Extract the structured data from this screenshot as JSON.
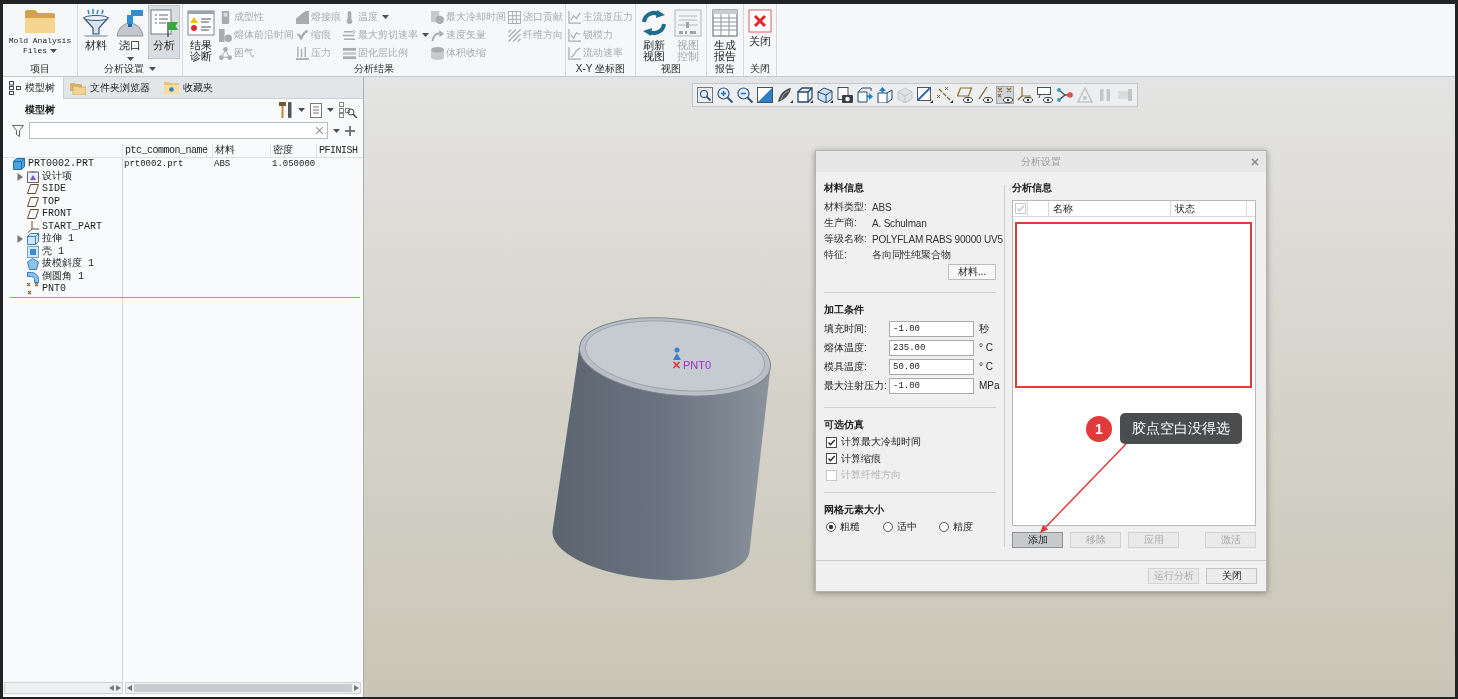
{
  "ribbon": {
    "groups": [
      {
        "label": "项目",
        "dropdown": false,
        "items": [
          {
            "kind": "folder",
            "label": "Mold Analysis Files",
            "dropdown": true,
            "disabled": false,
            "pressed": false
          }
        ]
      },
      {
        "label": "分析设置",
        "dropdown": true,
        "items": [
          {
            "kind": "funnel",
            "label": "材料",
            "dropdown": false,
            "disabled": false,
            "pressed": false
          },
          {
            "kind": "nozzle",
            "label": "浇口",
            "dropdown": true,
            "disabled": false,
            "pressed": false
          },
          {
            "kind": "analysis",
            "label": "分析",
            "dropdown": false,
            "disabled": false,
            "pressed": true
          }
        ]
      },
      {
        "label": "分析结果",
        "dropdown": false,
        "items": [
          {
            "kind": "diagnosis",
            "label": "结果诊断",
            "dropdown": false,
            "disabled": false,
            "pressed": false
          }
        ],
        "columns": [
          [
            {
              "label": "成型性",
              "dropdown": false,
              "disabled": true
            },
            {
              "label": "熔体前沿时间",
              "dropdown": false,
              "disabled": true
            },
            {
              "label": "困气",
              "dropdown": false,
              "disabled": true
            }
          ],
          [
            {
              "label": "熔接痕",
              "dropdown": false,
              "disabled": true
            },
            {
              "label": "缩痕",
              "dropdown": false,
              "disabled": true
            },
            {
              "label": "压力",
              "dropdown": false,
              "disabled": true
            }
          ],
          [
            {
              "label": "温度",
              "dropdown": true,
              "disabled": true
            },
            {
              "label": "最大剪切速率",
              "dropdown": true,
              "disabled": true
            },
            {
              "label": "固化层比例",
              "dropdown": false,
              "disabled": true
            }
          ],
          [
            {
              "label": "最大冷却时间",
              "dropdown": false,
              "disabled": true
            },
            {
              "label": "速度矢量",
              "dropdown": false,
              "disabled": true
            },
            {
              "label": "体积收缩",
              "dropdown": false,
              "disabled": true
            }
          ],
          [
            {
              "label": "浇口贡献",
              "dropdown": false,
              "disabled": true
            },
            {
              "label": "纤维方向",
              "dropdown": false,
              "disabled": true
            }
          ]
        ]
      },
      {
        "label": "X-Y 坐标图",
        "dropdown": false,
        "columns": [
          [
            {
              "label": "主流道压力",
              "dropdown": false,
              "disabled": true
            },
            {
              "label": "锁模力",
              "dropdown": false,
              "disabled": true
            },
            {
              "label": "流动速率",
              "dropdown": false,
              "disabled": true
            }
          ]
        ]
      },
      {
        "label": "视图",
        "dropdown": false,
        "items": [
          {
            "kind": "refresh",
            "label": "刷新视图",
            "dropdown": false,
            "disabled": false,
            "pressed": false
          },
          {
            "kind": "viewctl",
            "label": "视图控制",
            "dropdown": false,
            "disabled": true,
            "pressed": false
          }
        ]
      },
      {
        "label": "报告",
        "dropdown": false,
        "items": [
          {
            "kind": "report",
            "label": "生成报告",
            "dropdown": false,
            "disabled": false,
            "pressed": false
          }
        ]
      },
      {
        "label": "关闭",
        "dropdown": false,
        "items": [
          {
            "kind": "close",
            "label": "关闭",
            "dropdown": false,
            "disabled": false,
            "pressed": false
          }
        ]
      }
    ]
  },
  "model_tree": {
    "tabs": [
      {
        "label": "模型树",
        "selected": true
      },
      {
        "label": "文件夹浏览器",
        "selected": false
      },
      {
        "label": "收藏夹",
        "selected": false
      }
    ],
    "title": "模型树",
    "columns": [
      "ptc_common_name",
      "材料",
      "密度",
      "PFINISH"
    ],
    "items": [
      {
        "kind": "part",
        "name": "PRT0002.PRT",
        "cells": [
          "prt0002.prt",
          "ABS",
          "1.050000"
        ],
        "children": [
          {
            "kind": "items",
            "name": "设计项",
            "expanded": false
          },
          {
            "kind": "plane",
            "name": "SIDE"
          },
          {
            "kind": "plane",
            "name": "TOP"
          },
          {
            "kind": "plane",
            "name": "FRONT"
          },
          {
            "kind": "csys",
            "name": "START_PART"
          },
          {
            "kind": "extrude",
            "name": "拉伸 1",
            "expanded": false
          },
          {
            "kind": "shell",
            "name": "壳 1"
          },
          {
            "kind": "draft",
            "name": "拔模斜度 1"
          },
          {
            "kind": "round",
            "name": "倒圆角 1"
          },
          {
            "kind": "point",
            "name": "PNT0"
          }
        ]
      }
    ]
  },
  "graphics": {
    "toolbar": [
      {
        "kind": "fit",
        "on": false,
        "disabled": false
      },
      {
        "kind": "zoomin",
        "on": false,
        "disabled": false
      },
      {
        "kind": "zoomout",
        "on": false,
        "disabled": false
      },
      {
        "kind": "repaint",
        "on": false,
        "disabled": false
      },
      {
        "kind": "shading",
        "on": false,
        "disabled": false
      },
      {
        "kind": "style",
        "on": false,
        "disabled": false
      },
      {
        "kind": "views",
        "on": false,
        "disabled": false
      },
      {
        "kind": "manager",
        "on": false,
        "disabled": false
      },
      {
        "kind": "orientright",
        "on": false,
        "disabled": false
      },
      {
        "kind": "orientup",
        "on": false,
        "disabled": false
      },
      {
        "kind": "box",
        "on": false,
        "disabled": true
      },
      {
        "kind": "plane",
        "on": false,
        "disabled": false
      },
      {
        "kind": "axis",
        "on": false,
        "disabled": false
      },
      {
        "kind": "planetag",
        "on": false,
        "disabled": false
      },
      {
        "kind": "axistag",
        "on": false,
        "disabled": false
      },
      {
        "kind": "pointtag",
        "on": true,
        "disabled": false
      },
      {
        "kind": "csystag",
        "on": false,
        "disabled": false
      },
      {
        "kind": "notetag",
        "on": false,
        "disabled": false
      },
      {
        "kind": "spin",
        "on": false,
        "disabled": false
      },
      {
        "kind": "warn",
        "on": false,
        "disabled": true
      },
      {
        "kind": "pause",
        "on": false,
        "disabled": true
      },
      {
        "kind": "last",
        "on": false,
        "disabled": true
      }
    ],
    "point_label": "PNT0"
  },
  "dialog": {
    "title": "分析设置",
    "material_info": {
      "heading": "材料信息",
      "rows": [
        {
          "label": "材料类型:",
          "value": "ABS"
        },
        {
          "label": "生产商:",
          "value": "A. Schulman"
        },
        {
          "label": "等级名称:",
          "value": "POLYFLAM RABS 90000 UV5"
        },
        {
          "label": "特征:",
          "value": "各向同性纯聚合物"
        }
      ],
      "button": "材料..."
    },
    "process_conditions": {
      "heading": "加工条件",
      "fields": [
        {
          "label": "填充时间:",
          "value": "-1.00",
          "unit": "秒"
        },
        {
          "label": "熔体温度:",
          "value": "235.00",
          "unit": "° C"
        },
        {
          "label": "模具温度:",
          "value": "50.00",
          "unit": "° C"
        },
        {
          "label": "最大注射压力:",
          "value": "-1.00",
          "unit": "MPa"
        }
      ]
    },
    "optional_simulation": {
      "heading": "可选仿真",
      "options": [
        {
          "label": "计算最大冷却时间",
          "checked": true,
          "disabled": false
        },
        {
          "label": "计算缩痕",
          "checked": true,
          "disabled": false
        },
        {
          "label": "计算纤维方向",
          "checked": false,
          "disabled": true
        }
      ]
    },
    "mesh_size": {
      "heading": "网格元素大小",
      "options": [
        {
          "label": "粗糙",
          "selected": true
        },
        {
          "label": "适中",
          "selected": false
        },
        {
          "label": "精度",
          "selected": false
        }
      ]
    },
    "analysis_info": {
      "heading": "分析信息",
      "header_checkbox": {
        "checked": true,
        "disabled": true
      },
      "columns": [
        "名称",
        "状态"
      ],
      "buttons": [
        {
          "label": "添加",
          "disabled": false,
          "pressed": true
        },
        {
          "label": "移除",
          "disabled": true,
          "pressed": false
        },
        {
          "label": "应用",
          "disabled": true,
          "pressed": false
        },
        {
          "label": "激活",
          "disabled": true,
          "pressed": false
        }
      ]
    },
    "footer_buttons": [
      {
        "label": "运行分析",
        "disabled": true
      },
      {
        "label": "关闭",
        "disabled": false
      }
    ]
  },
  "annotation": {
    "number": "1",
    "text": "胶点空白没得选"
  }
}
